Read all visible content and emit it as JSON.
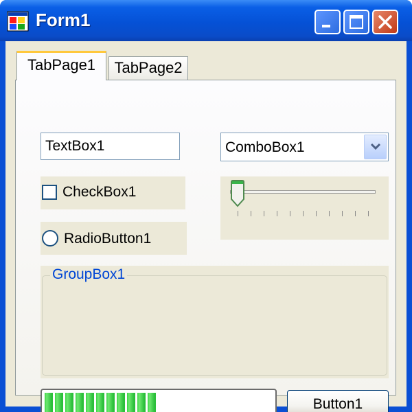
{
  "window": {
    "title": "Form1",
    "icon": "form-app-icon",
    "controls": {
      "minimize_icon": "minimize-icon",
      "maximize_icon": "maximize-icon",
      "close_icon": "close-icon"
    }
  },
  "tabs": [
    {
      "label": "TabPage1",
      "selected": true
    },
    {
      "label": "TabPage2",
      "selected": false
    }
  ],
  "textbox": {
    "value": "TextBox1"
  },
  "combobox": {
    "value": "ComboBox1",
    "icon": "chevron-down-icon"
  },
  "checkbox": {
    "label": "CheckBox1",
    "checked": false
  },
  "radio": {
    "label": "RadioButton1",
    "selected": false
  },
  "trackbar": {
    "value": 0,
    "min": 0,
    "max": 10,
    "tick_count": 11
  },
  "groupbox": {
    "caption": "GroupBox1"
  },
  "progress": {
    "value_fraction": 0.5
  },
  "button": {
    "label": "Button1"
  },
  "colors": {
    "titlebar": "#0551d6",
    "client": "#ece9d8",
    "progress_fill": "#2bbf3a",
    "group_caption": "#0046d5",
    "tab_highlight": "#ffc83c"
  }
}
